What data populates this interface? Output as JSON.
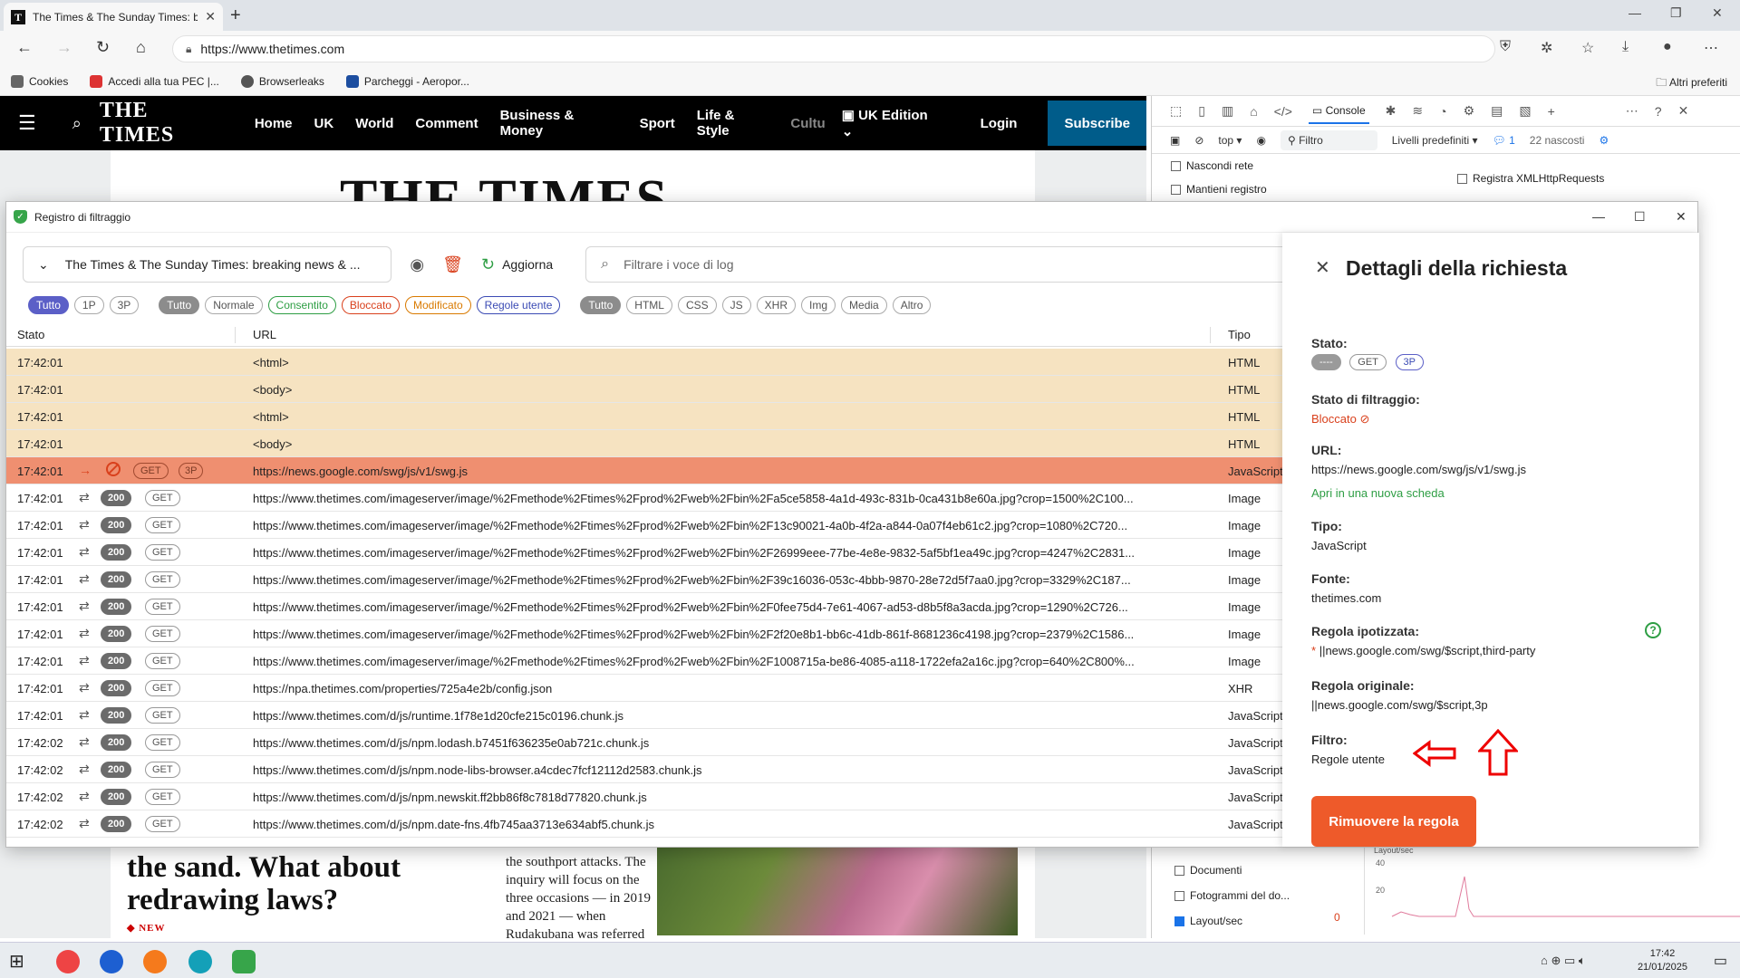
{
  "browser": {
    "tab_title": "The Times & The Sunday Times: b",
    "url": "https://www.thetimes.com",
    "bookmarks": [
      "Cookies",
      "Accedi alla tua PEC |...",
      "Browserleaks",
      "Parcheggi - Aeropor..."
    ],
    "other_favorites": "Altri preferiti"
  },
  "times": {
    "logo": "THE TIMES",
    "nav": [
      "Home",
      "UK",
      "World",
      "Comment",
      "Business & Money",
      "Sport",
      "Life & Style",
      "Cultu"
    ],
    "edition": "UK Edition",
    "login": "Login",
    "subscribe": "Subscribe",
    "headline": "the sand. What about redrawing laws?",
    "new_tag": "NEW",
    "article_text": "the southport attacks. The inquiry will focus on the three occasions — in 2019 and 2021 — when Rudakubana was referred to the..."
  },
  "devtools": {
    "console_tab": "Console",
    "context": "top",
    "filter": "Filtro",
    "levels": "Livelli predefiniti",
    "issues_count": "1",
    "hidden": "22 nascosti",
    "options_left": [
      "Nascondi rete",
      "Mantieni registro"
    ],
    "options_right": "Registra XMLHttpRequests",
    "bottom_options": [
      "Documenti",
      "Fotogrammi del do...",
      "Layout/sec"
    ],
    "layout_count": "0",
    "graph_label": "Layout/sec",
    "graph_ticks": [
      "40",
      "20"
    ]
  },
  "filter_log": {
    "window_title": "Registro di filtraggio",
    "page_select": "The Times & The Sunday Times: breaking news & ...",
    "refresh_label": "Aggiorna",
    "search_placeholder": "Filtrare i voce di log",
    "chips_party": [
      "Tutto",
      "1P",
      "3P"
    ],
    "chips_state": [
      "Tutto",
      "Normale",
      "Consentito",
      "Bloccato",
      "Modificato",
      "Regole utente"
    ],
    "chips_type": [
      "Tutto",
      "HTML",
      "CSS",
      "JS",
      "XHR",
      "Img",
      "Media",
      "Altro"
    ],
    "columns": {
      "stato": "Stato",
      "url": "URL",
      "tipo": "Tipo"
    },
    "rows": [
      {
        "time": "17:42:01",
        "kind": "doc",
        "url": "<html>",
        "type": "HTML"
      },
      {
        "time": "17:42:01",
        "kind": "doc",
        "url": "<body>",
        "type": "HTML"
      },
      {
        "time": "17:42:01",
        "kind": "doc",
        "url": "<html>",
        "type": "HTML"
      },
      {
        "time": "17:42:01",
        "kind": "doc",
        "url": "<body>",
        "type": "HTML"
      },
      {
        "time": "17:42:01",
        "kind": "blocked",
        "method": "GET",
        "party": "3P",
        "url": "https://news.google.com/swg/js/v1/swg.js",
        "type": "JavaScript"
      },
      {
        "time": "17:42:01",
        "kind": "ok",
        "status": "200",
        "method": "GET",
        "url": "https://www.thetimes.com/imageserver/image/%2Fmethode%2Ftimes%2Fprod%2Fweb%2Fbin%2Fa5ce5858-4a1d-493c-831b-0ca431b8e60a.jpg?crop=1500%2C100...",
        "type": "Image"
      },
      {
        "time": "17:42:01",
        "kind": "ok",
        "status": "200",
        "method": "GET",
        "url": "https://www.thetimes.com/imageserver/image/%2Fmethode%2Ftimes%2Fprod%2Fweb%2Fbin%2F13c90021-4a0b-4f2a-a844-0a07f4eb61c2.jpg?crop=1080%2C720...",
        "type": "Image"
      },
      {
        "time": "17:42:01",
        "kind": "ok",
        "status": "200",
        "method": "GET",
        "url": "https://www.thetimes.com/imageserver/image/%2Fmethode%2Ftimes%2Fprod%2Fweb%2Fbin%2F26999eee-77be-4e8e-9832-5af5bf1ea49c.jpg?crop=4247%2C2831...",
        "type": "Image"
      },
      {
        "time": "17:42:01",
        "kind": "ok",
        "status": "200",
        "method": "GET",
        "url": "https://www.thetimes.com/imageserver/image/%2Fmethode%2Ftimes%2Fprod%2Fweb%2Fbin%2F39c16036-053c-4bbb-9870-28e72d5f7aa0.jpg?crop=3329%2C187...",
        "type": "Image"
      },
      {
        "time": "17:42:01",
        "kind": "ok",
        "status": "200",
        "method": "GET",
        "url": "https://www.thetimes.com/imageserver/image/%2Fmethode%2Ftimes%2Fprod%2Fweb%2Fbin%2F0fee75d4-7e61-4067-ad53-d8b5f8a3acda.jpg?crop=1290%2C726...",
        "type": "Image"
      },
      {
        "time": "17:42:01",
        "kind": "ok",
        "status": "200",
        "method": "GET",
        "url": "https://www.thetimes.com/imageserver/image/%2Fmethode%2Ftimes%2Fprod%2Fweb%2Fbin%2F2f20e8b1-bb6c-41db-861f-8681236c4198.jpg?crop=2379%2C1586...",
        "type": "Image"
      },
      {
        "time": "17:42:01",
        "kind": "ok",
        "status": "200",
        "method": "GET",
        "url": "https://www.thetimes.com/imageserver/image/%2Fmethode%2Ftimes%2Fprod%2Fweb%2Fbin%2F1008715a-be86-4085-a118-1722efa2a16c.jpg?crop=640%2C800%...",
        "type": "Image"
      },
      {
        "time": "17:42:01",
        "kind": "ok",
        "status": "200",
        "method": "GET",
        "url": "https://npa.thetimes.com/properties/725a4e2b/config.json",
        "type": "XHR"
      },
      {
        "time": "17:42:01",
        "kind": "ok",
        "status": "200",
        "method": "GET",
        "url": "https://www.thetimes.com/d/js/runtime.1f78e1d20cfe215c0196.chunk.js",
        "type": "JavaScript"
      },
      {
        "time": "17:42:02",
        "kind": "ok",
        "status": "200",
        "method": "GET",
        "url": "https://www.thetimes.com/d/js/npm.lodash.b7451f636235e0ab721c.chunk.js",
        "type": "JavaScript"
      },
      {
        "time": "17:42:02",
        "kind": "ok",
        "status": "200",
        "method": "GET",
        "url": "https://www.thetimes.com/d/js/npm.node-libs-browser.a4cdec7fcf12112d2583.chunk.js",
        "type": "JavaScript"
      },
      {
        "time": "17:42:02",
        "kind": "ok",
        "status": "200",
        "method": "GET",
        "url": "https://www.thetimes.com/d/js/npm.newskit.ff2bb86f8c7818d77820.chunk.js",
        "type": "JavaScript"
      },
      {
        "time": "17:42:02",
        "kind": "ok",
        "status": "200",
        "method": "GET",
        "url": "https://www.thetimes.com/d/js/npm.date-fns.4fb745aa3713e634abf5.chunk.js",
        "type": "JavaScript"
      }
    ]
  },
  "details": {
    "title": "Dettagli della richiesta",
    "stato_label": "Stato:",
    "stato_chips": [
      "----",
      "GET",
      "3P"
    ],
    "filter_state_label": "Stato di filtraggio:",
    "filter_state": "Bloccato",
    "url_label": "URL:",
    "url": "https://news.google.com/swg/js/v1/swg.js",
    "open_tab": "Apri in una nuova scheda",
    "type_label": "Tipo:",
    "type": "JavaScript",
    "source_label": "Fonte:",
    "source": "thetimes.com",
    "hyp_rule_label": "Regola ipotizzata:",
    "hyp_rule_marker": "*",
    "hyp_rule": "||news.google.com/swg/$script,third-party",
    "orig_rule_label": "Regola originale:",
    "orig_rule": "||news.google.com/swg/$script,3p",
    "filter_label": "Filtro:",
    "filter": "Regole utente",
    "remove_button": "Rimuovere la regola"
  },
  "taskbar": {
    "time": "17:42",
    "date": "21/01/2025"
  }
}
